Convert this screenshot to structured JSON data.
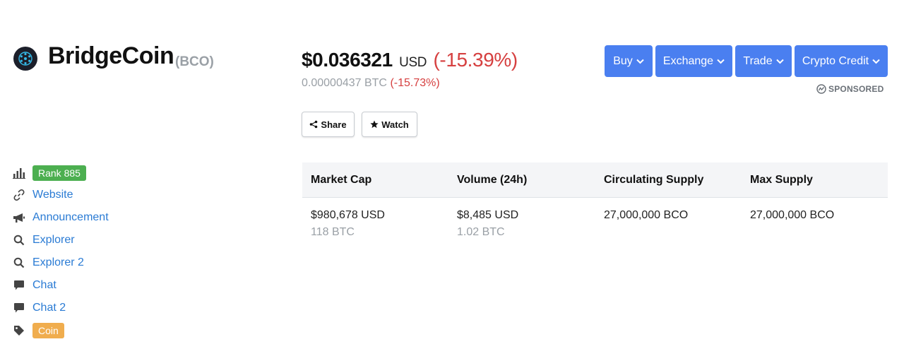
{
  "coin": {
    "name": "BridgeCoin",
    "symbol": "(BCO)"
  },
  "price": {
    "usd": "$0.036321",
    "unit": "USD",
    "change": "(-15.39%)",
    "btc": "0.00000437 BTC",
    "btc_change": "(-15.73%)"
  },
  "actions": [
    "Buy",
    "Exchange",
    "Trade",
    "Crypto Credit"
  ],
  "sponsored": "SPONSORED",
  "buttons": {
    "share": "Share",
    "watch": "Watch"
  },
  "sidebar": {
    "rank": "Rank 885",
    "links": [
      "Website",
      "Announcement",
      "Explorer",
      "Explorer 2",
      "Chat",
      "Chat 2"
    ],
    "tag": "Coin"
  },
  "stats": {
    "headers": [
      "Market Cap",
      "Volume (24h)",
      "Circulating Supply",
      "Max Supply"
    ],
    "values": [
      "$980,678 USD",
      "$8,485 USD",
      "27,000,000 BCO",
      "27,000,000 BCO"
    ],
    "sub_values": [
      "118 BTC",
      "1.02 BTC"
    ]
  },
  "colors": {
    "accent": "#4a7ff0",
    "negative": "#d64040",
    "link": "#2a7bd4",
    "rank_badge": "#4caf50",
    "coin_badge": "#f0ad4e"
  },
  "icons": [
    "coin-logo-icon",
    "chevron-down-icon",
    "sponsored-icon",
    "share-icon",
    "star-icon",
    "bar-chart-icon",
    "link-icon",
    "megaphone-icon",
    "search-icon",
    "chat-icon",
    "tag-icon"
  ]
}
